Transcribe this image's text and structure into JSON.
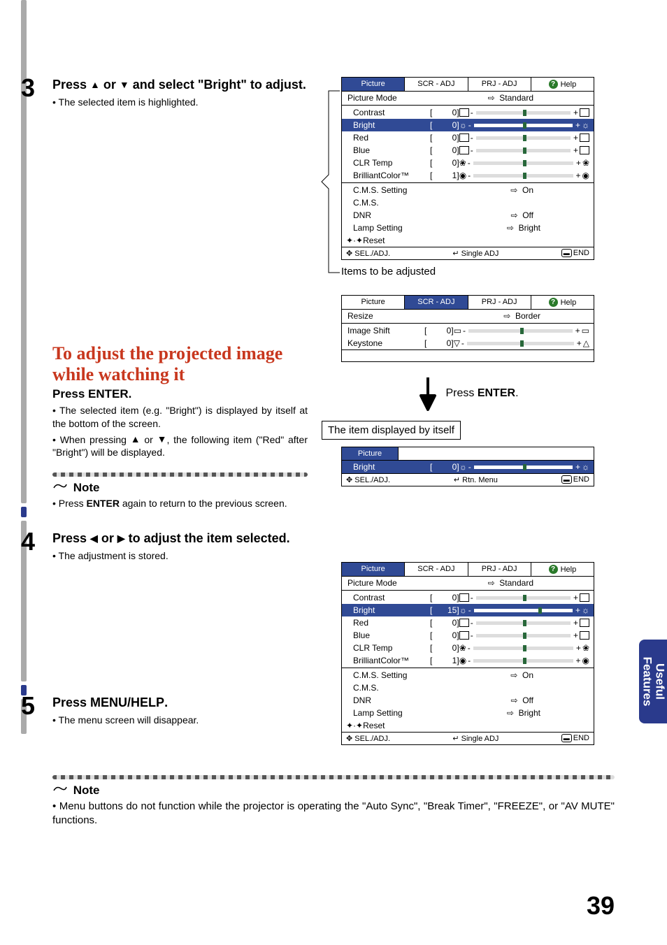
{
  "page_number": "39",
  "side_tab_line1": "Useful",
  "side_tab_line2": "Features",
  "step3": {
    "num": "3",
    "title_a": "Press ",
    "title_b": " or ",
    "title_c": " and select \"Bright\" to adjust.",
    "bullet": "The selected item is highlighted."
  },
  "adjust_heading": "To adjust the projected image while watching it",
  "press_enter_sub": "Press ENTER.",
  "press_enter_detail1": "The selected item (e.g. \"Bright\") is displayed by itself at the bottom of the screen.",
  "press_enter_detail2_a": "When pressing ",
  "press_enter_detail2_b": " or ",
  "press_enter_detail2_c": ", the following item (\"Red\" after \"Bright\") will be displayed.",
  "note_label": "Note",
  "note1_text_a": "Press ",
  "note1_text_b": "ENTER",
  "note1_text_c": " again to return to the previous screen.",
  "step4": {
    "num": "4",
    "title_a": "Press ",
    "title_b": " or ",
    "title_c": " to adjust the item selected.",
    "bullet": "The adjustment is stored."
  },
  "step5": {
    "num": "5",
    "title": "Press MENU/HELP.",
    "bullet": "The menu screen will disappear."
  },
  "final_note": "Menu buttons do not function while the projector is operating the \"Auto Sync\", \"Break Timer\", \"FREEZE\", or \"AV MUTE\" functions.",
  "items_caption": "Items to be adjusted",
  "enter_arrow_label": "Press ENTER.",
  "displayed_by_itself": "The item displayed by itself",
  "osd_tabs": {
    "picture": "Picture",
    "scr": "SCR - ADJ",
    "prj": "PRJ - ADJ",
    "help": "Help"
  },
  "osd_footer": {
    "sel": "SEL./ADJ.",
    "single": "Single ADJ",
    "rtn": "Rtn. Menu",
    "end": "END"
  },
  "osd1": {
    "picture_mode": "Picture Mode",
    "picture_mode_val": "Standard",
    "contrast": "Contrast",
    "contrast_val": "0",
    "bright": "Bright",
    "bright_val": "0",
    "red": "Red",
    "red_val": "0",
    "blue": "Blue",
    "blue_val": "0",
    "clr": "CLR Temp",
    "clr_val": "0",
    "bc": "BrilliantColor™",
    "bc_val": "1",
    "cms_set": "C.M.S. Setting",
    "cms_set_val": "On",
    "cms": "C.M.S.",
    "dnr": "DNR",
    "dnr_val": "Off",
    "lamp": "Lamp Setting",
    "lamp_val": "Bright",
    "reset": "Reset"
  },
  "osd2": {
    "resize": "Resize",
    "resize_val": "Border",
    "shift": "Image Shift",
    "shift_val": "0",
    "keystone": "Keystone",
    "keystone_val": "0"
  },
  "osd_single": {
    "tab": "Picture",
    "bright": "Bright",
    "bright_val": "0"
  },
  "osd3_bright_val": "15"
}
